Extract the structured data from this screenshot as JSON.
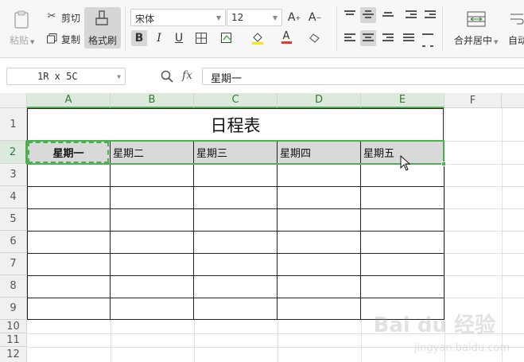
{
  "ribbon": {
    "paste_label": "粘贴",
    "cut_label": "剪切",
    "copy_label": "复制",
    "format_painter_label": "格式刷",
    "font_name": "宋体",
    "font_size": "12",
    "merge_center_label": "合并居中",
    "auto_wrap_label": "自动"
  },
  "formula_bar": {
    "name_box": "1R x 5C",
    "fx_label": "fx",
    "formula_value": "星期一"
  },
  "sheet": {
    "columns": [
      "A",
      "B",
      "C",
      "D",
      "E",
      "F"
    ],
    "rows": [
      "1",
      "2",
      "3",
      "4",
      "5",
      "6",
      "7",
      "8",
      "9",
      "10",
      "11",
      "12"
    ],
    "title": "日程表",
    "header_row": [
      "星期一",
      "星期二",
      "星期三",
      "星期四",
      "星期五"
    ]
  },
  "watermark": {
    "brand": "Bai du 经验",
    "url": "jingyan.baidu.com"
  }
}
